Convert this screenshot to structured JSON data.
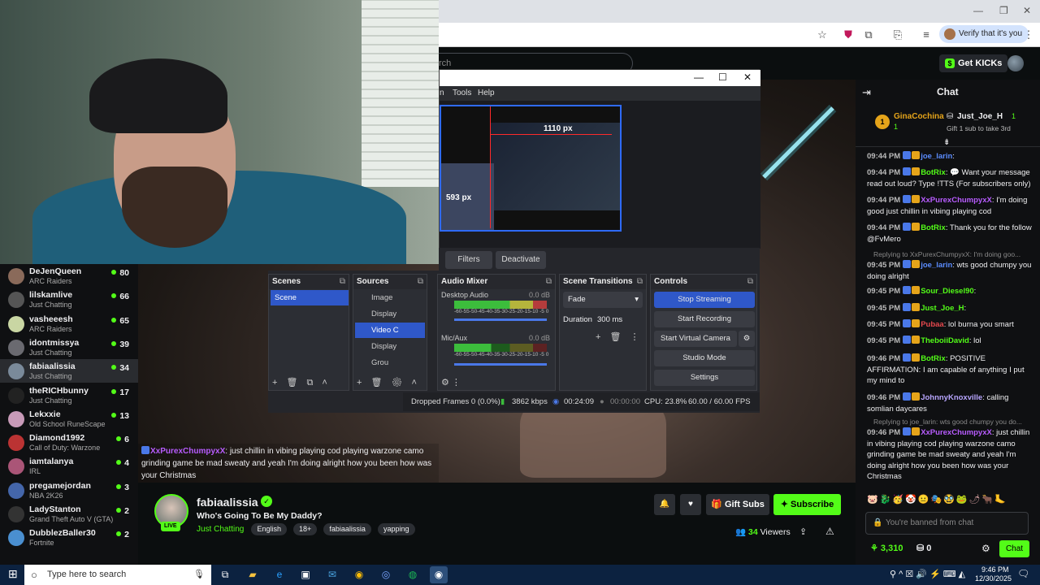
{
  "browser": {
    "verify_label": "Verify that it's you"
  },
  "header": {
    "search_placeholder": "rch",
    "kicks_label": "Get KICKs"
  },
  "obs": {
    "menu": [
      "n",
      "Tools",
      "Help"
    ],
    "preview_width_label": "1110 px",
    "preview_height_label": "593 px",
    "filters_label": "Filters",
    "deactivate_label": "Deactivate",
    "scenes_title": "Scenes",
    "scene_item": "Scene",
    "sources_title": "Sources",
    "sources": [
      "Image",
      "Display",
      "Video C",
      "Display",
      "Grou"
    ],
    "audio_title": "Audio Mixer",
    "desktop_audio": "Desktop Audio",
    "desktop_db": "0.0 dB",
    "mic_audio": "Mic/Aux",
    "mic_db": "0.0 dB",
    "meter_scale": "-60-55-50-45-40-35-30-25-20-15-10 -5 0",
    "transitions_title": "Scene Transitions",
    "transition_value": "Fade",
    "duration_label": "Duration",
    "duration_value": "300 ms",
    "controls_title": "Controls",
    "controls": [
      "Stop Streaming",
      "Start Recording",
      "Start Virtual Camera",
      "Studio Mode",
      "Settings"
    ],
    "status": {
      "dropped": "Dropped Frames 0 (0.0%)",
      "bitrate": "3862 kbps",
      "stream_time": "00:24:09",
      "rec_time": "00:00:00",
      "cpu": "CPU: 23.8%",
      "fps": "60.00 / 60.00 FPS"
    }
  },
  "sidebar": {
    "channels": [
      {
        "name": "DeJenQueen",
        "category": "ARC Raiders",
        "viewers": "80",
        "color": "#8a6a5a"
      },
      {
        "name": "lilskamlive",
        "category": "Just Chatting",
        "viewers": "66",
        "color": "#555"
      },
      {
        "name": "vasheeesh",
        "category": "ARC Raiders",
        "viewers": "65",
        "color": "#c9d6a3"
      },
      {
        "name": "idontmissya",
        "category": "Just Chatting",
        "viewers": "39",
        "color": "#6a6a70"
      },
      {
        "name": "fabiaalissia",
        "category": "Just Chatting",
        "viewers": "34",
        "color": "#7a8a9a"
      },
      {
        "name": "theRICHbunny",
        "category": "Just Chatting",
        "viewers": "17",
        "color": "#222"
      },
      {
        "name": "Lekxxie",
        "category": "Old School RuneScape",
        "viewers": "13",
        "color": "#c89ab8"
      },
      {
        "name": "Diamond1992",
        "category": "Call of Duty: Warzone",
        "viewers": "6",
        "color": "#b33"
      },
      {
        "name": "iamtalanya",
        "category": "IRL",
        "viewers": "4",
        "color": "#a57"
      },
      {
        "name": "pregamejordan",
        "category": "NBA 2K26",
        "viewers": "3",
        "color": "#46a"
      },
      {
        "name": "LadyStanton",
        "category": "Grand Theft Auto V (GTA)",
        "viewers": "2",
        "color": "#333"
      },
      {
        "name": "DubblezBaller30",
        "category": "Fortnite",
        "viewers": "2",
        "color": "#4a8fd0"
      }
    ]
  },
  "overlay_chat": {
    "user": "XxPurexChumpyxX",
    "text": ": just chillin in vibing playing cod playing warzone camo grinding game be mad sweaty and yeah I'm doing alright how you been how was your Christmas"
  },
  "stream": {
    "channel": "fabiaalissia",
    "title": "Who's Going To Be My Daddy?",
    "category": "Just Chatting",
    "live_badge": "LIVE",
    "tags": [
      "English",
      "18+",
      "fabiaalissia",
      "yapping"
    ],
    "gift_label": "Gift Subs",
    "subscribe_label": "Subscribe",
    "viewers_count": "34",
    "viewers_label": "Viewers"
  },
  "chat": {
    "title": "Chat",
    "pinned": {
      "user1": "GinaCochina",
      "user1_count": "1",
      "user1_rank": "1",
      "user2": "Just_Joe_H",
      "user2_count": "1",
      "user2_note": "Gift 1 sub to take 3rd"
    },
    "messages": [
      {
        "time": "09:44 PM",
        "user": "joe_larin",
        "color": "#5b8cff",
        "text": ":"
      },
      {
        "time": "09:44 PM",
        "user": "BotRix",
        "color": "#53fc18",
        "text": ": 💬 Want your message read out loud? Type !TTS (For subscribers only)"
      },
      {
        "time": "09:44 PM",
        "user": "XxPurexChumpyxX",
        "color": "#b85cff",
        "text": ": I'm doing good just chillin in vibing playing cod"
      },
      {
        "time": "09:44 PM",
        "user": "BotRix",
        "color": "#53fc18",
        "text": ": Thank you for the follow @FvMero"
      },
      {
        "time": "09:45 PM",
        "user": "joe_larin",
        "color": "#5b8cff",
        "text": ": wts good chumpy you doing alright",
        "reply": "Replying to XxPurexChumpyxX: I'm doing goo..."
      },
      {
        "time": "09:45 PM",
        "user": "Sour_Diesel90",
        "color": "#53fc18",
        "text": ":"
      },
      {
        "time": "09:45 PM",
        "user": "Just_Joe_H",
        "color": "#53fc18",
        "text": ":"
      },
      {
        "time": "09:45 PM",
        "user": "Pubaa",
        "color": "#e5484d",
        "text": ": lol burna you smart"
      },
      {
        "time": "09:45 PM",
        "user": "TheboiiDavid",
        "color": "#53fc18",
        "text": ": lol"
      },
      {
        "time": "09:46 PM",
        "user": "BotRix",
        "color": "#53fc18",
        "text": ": POSITIVE AFFIRMATION: I am capable of anything I put my mind to"
      },
      {
        "time": "09:46 PM",
        "user": "JohnnyKnoxville",
        "color": "#b8a6ff",
        "text": ": calling somlian daycares"
      },
      {
        "time": "09:46 PM",
        "user": "XxPurexChumpyxX",
        "color": "#b85cff",
        "text": ": just chillin in vibing playing cod playing warzone camo grinding game be mad sweaty and yeah I'm doing alright how you been how was your Christmas",
        "reply": "Replying to joe_larin: wts good chumpy you do..."
      }
    ],
    "banned_text": "You're banned from chat",
    "kicks_balance": "3,310",
    "items_count": "0",
    "chat_button": "Chat"
  },
  "taskbar": {
    "search_placeholder": "Type here to search",
    "time": "9:46 PM",
    "date": "12/30/2025"
  }
}
